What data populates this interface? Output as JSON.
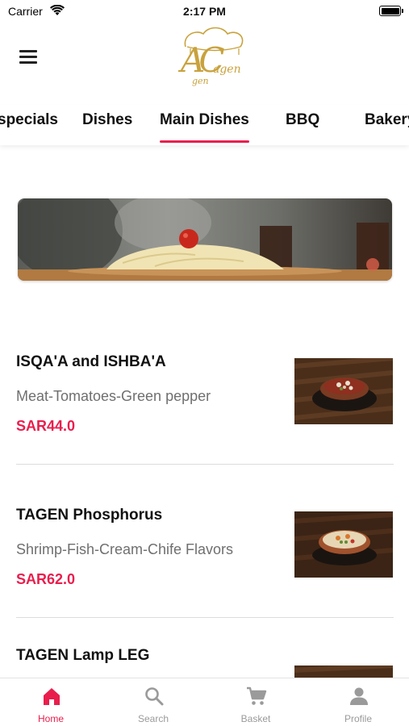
{
  "status_bar": {
    "carrier": "Carrier",
    "time": "2:17 PM"
  },
  "header": {
    "logo_letters": "AC",
    "logo_word_1": "agen",
    "logo_word_2": "gen"
  },
  "tabs": [
    {
      "label": "specials"
    },
    {
      "label": "Dishes"
    },
    {
      "label": "Main Dishes",
      "active": true
    },
    {
      "label": "BBQ"
    },
    {
      "label": "Bakery"
    }
  ],
  "products": [
    {
      "name": "ISQA'A and ISHBA'A",
      "description": "Meat-Tomatoes-Green pepper",
      "price": "SAR44.0"
    },
    {
      "name": "TAGEN Phosphorus",
      "description": "Shrimp-Fish-Cream-Chife Flavors",
      "price": "SAR62.0"
    },
    {
      "name": "TAGEN Lamp LEG",
      "description": "",
      "price": ""
    }
  ],
  "tabbar": [
    {
      "label": "Home",
      "icon": "home-icon",
      "active": true
    },
    {
      "label": "Search",
      "icon": "search-icon"
    },
    {
      "label": "Basket",
      "icon": "cart-icon"
    },
    {
      "label": "Profile",
      "icon": "profile-icon"
    }
  ],
  "colors": {
    "accent": "#e91e4d",
    "logo_gold": "#c9a23d",
    "muted_text": "#6f6f6f",
    "tab_inactive": "#9a9a9a"
  }
}
